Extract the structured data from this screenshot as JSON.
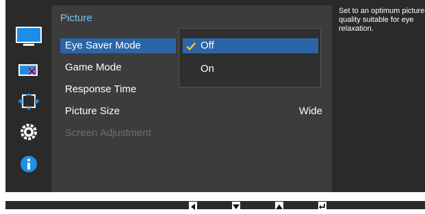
{
  "menu": {
    "title": "Picture",
    "items": [
      {
        "label": "Eye Saver Mode"
      },
      {
        "label": "Game Mode"
      },
      {
        "label": "Response Time"
      },
      {
        "label": "Picture Size",
        "value": "Wide"
      },
      {
        "label": "Screen Adjustment"
      }
    ]
  },
  "dropdown": {
    "options": [
      {
        "label": "Off",
        "selected": true
      },
      {
        "label": "On",
        "selected": false
      }
    ]
  },
  "help_text": "Set to an optimum picture quality suitable for eye relaxation.",
  "sidebar": {
    "icons": [
      "picture-icon",
      "color-icon",
      "size-position-icon",
      "settings-icon",
      "info-icon"
    ]
  },
  "bottom_keys": [
    "left-arrow-key-icon",
    "down-arrow-key-icon",
    "up-arrow-key-icon",
    "enter-key-icon"
  ],
  "colors": {
    "accent": "#7ec6f2",
    "highlight": "#2b65a6",
    "check": "#f2c230",
    "info": "#1e90e8"
  }
}
